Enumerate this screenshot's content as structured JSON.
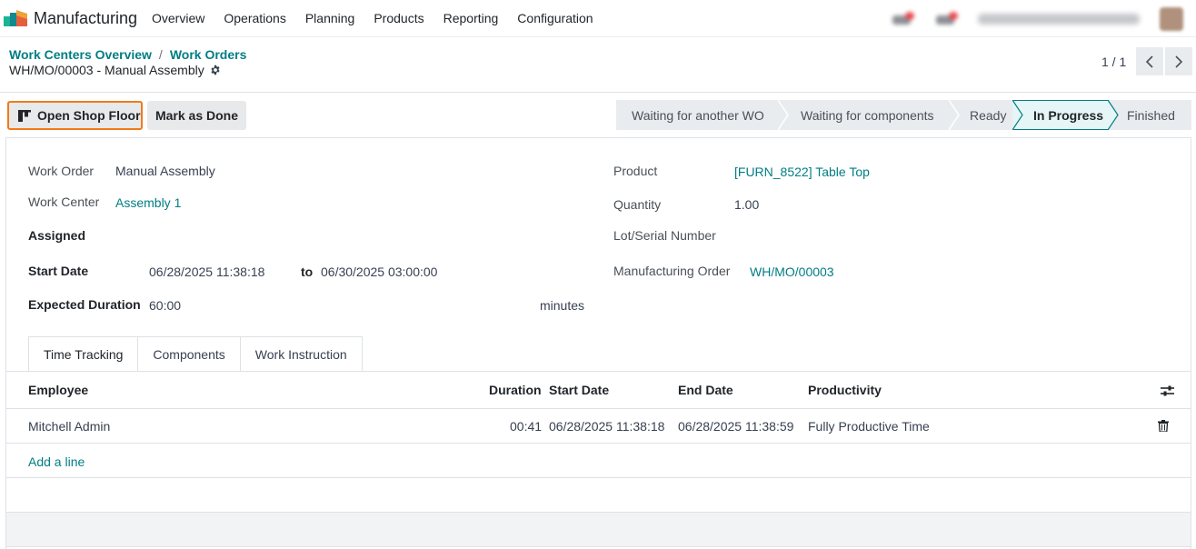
{
  "navbar": {
    "app_title": "Manufacturing",
    "menu": [
      "Overview",
      "Operations",
      "Planning",
      "Products",
      "Reporting",
      "Configuration"
    ]
  },
  "breadcrumb": {
    "items": [
      "Work Centers Overview",
      "Work Orders"
    ],
    "separator": "/",
    "record": "WH/MO/00003 - Manual Assembly"
  },
  "pager": {
    "text": "1 / 1"
  },
  "actions": {
    "open_shop_floor": "Open Shop Floor",
    "mark_as_done": "Mark as Done"
  },
  "status": {
    "stages": [
      "Waiting for another WO",
      "Waiting for components",
      "Ready",
      "In Progress",
      "Finished"
    ],
    "current": "In Progress"
  },
  "form": {
    "work_order_label": "Work Order",
    "work_order": "Manual Assembly",
    "work_center_label": "Work Center",
    "work_center": "Assembly 1",
    "assigned_label": "Assigned",
    "start_date_label": "Start Date",
    "start_date": "06/28/2025 11:38:18",
    "to_label": "to",
    "end_date": "06/30/2025 03:00:00",
    "expected_duration_label": "Expected Duration",
    "expected_duration": "60:00",
    "duration_unit": "minutes",
    "product_label": "Product",
    "product": "[FURN_8522] Table Top",
    "quantity_label": "Quantity",
    "quantity": "1.00",
    "lot_label": "Lot/Serial Number",
    "mo_label": "Manufacturing Order",
    "mo": "WH/MO/00003"
  },
  "tabs": [
    "Time Tracking",
    "Components",
    "Work Instruction"
  ],
  "table": {
    "columns": [
      "Employee",
      "Duration",
      "Start Date",
      "End Date",
      "Productivity"
    ],
    "rows": [
      {
        "employee": "Mitchell Admin",
        "duration": "00:41",
        "start": "06/28/2025 11:38:18",
        "end": "06/28/2025 11:38:59",
        "productivity": "Fully Productive Time"
      }
    ],
    "add_line": "Add a line"
  },
  "colors": {
    "accent": "#017e84",
    "highlight": "#f27a1a",
    "stage_current": "#e6f5f6"
  }
}
